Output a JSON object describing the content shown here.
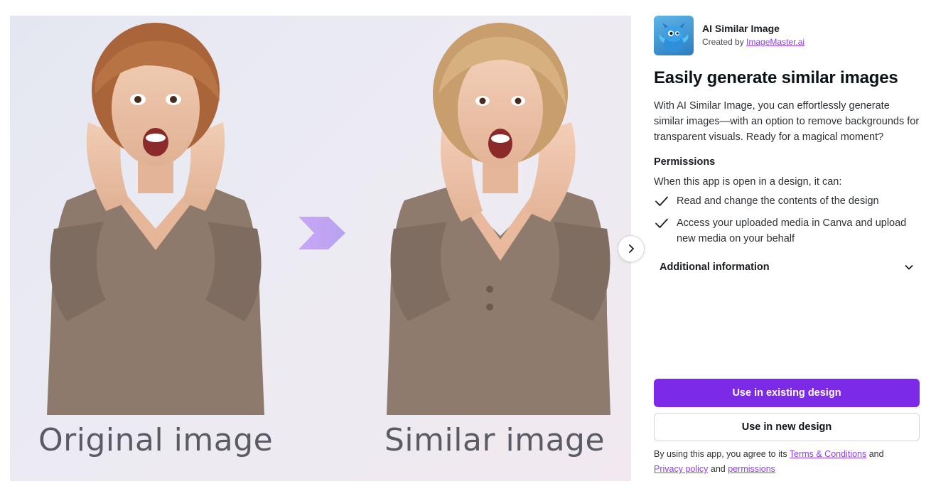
{
  "preview": {
    "left_caption": "Original image",
    "right_caption": "Similar image",
    "next_icon": "chevron-right-icon",
    "arrow_icon": "chevron-arrow-icon"
  },
  "app": {
    "name": "AI Similar Image",
    "created_by_prefix": "Created by",
    "creator": "ImageMaster.ai",
    "icon": "dragon-mascot-icon"
  },
  "headline": "Easily generate similar images",
  "description": "With AI Similar Image, you can effortlessly generate similar images—with an option to remove backgrounds for transparent visuals. Ready for a magical moment?",
  "permissions": {
    "title": "Permissions",
    "intro": "When this app is open in a design, it can:",
    "items": [
      {
        "text": "Read and change the contents of the design"
      },
      {
        "text": "Access your uploaded media in Canva and upload new media on your behalf"
      }
    ]
  },
  "additional_info": {
    "label": "Additional information",
    "icon": "chevron-down-icon"
  },
  "buttons": {
    "primary": "Use in existing design",
    "secondary": "Use in new design"
  },
  "legal": {
    "prefix": "By using this app, you agree to its",
    "terms": "Terms & Conditions",
    "and1": "and",
    "privacy": "Privacy policy",
    "and2": "and",
    "permissions": "permissions"
  },
  "colors": {
    "accent": "#7d2ae8",
    "link": "#8b3dff",
    "arrow_start": "#c9a6f5",
    "arrow_end": "#8ab4f8"
  }
}
